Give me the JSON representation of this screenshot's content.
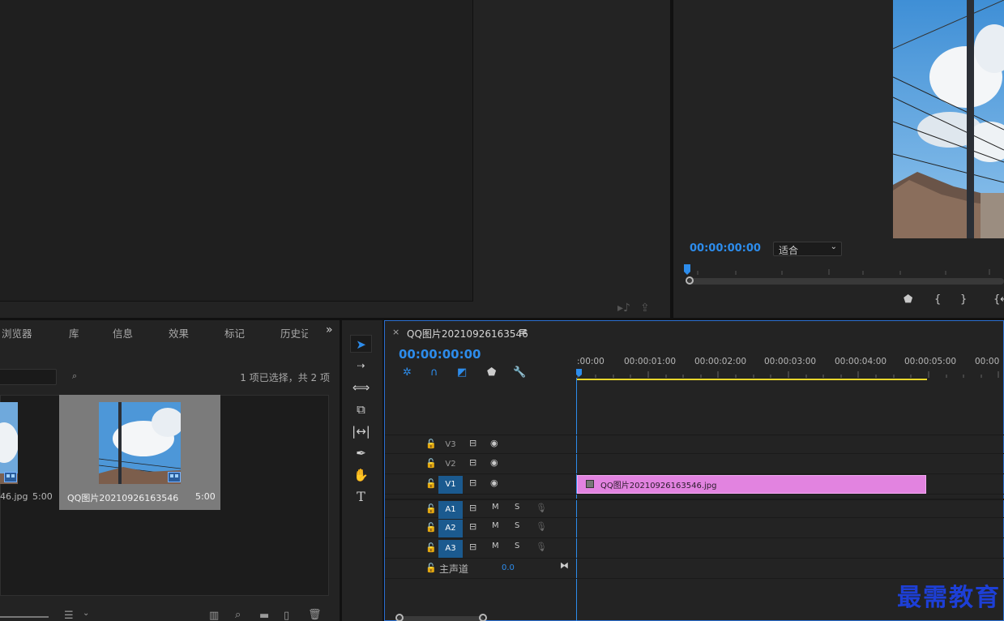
{
  "program": {
    "timecode": "00:00:00:00",
    "fit_label": "适合"
  },
  "project": {
    "tabs": [
      "浏览器",
      "库",
      "信息",
      "效果",
      "标记",
      "历史记"
    ],
    "selection_count": "1 项已选择，共 2 项",
    "items": [
      {
        "name": "46.jpg",
        "duration": "5:00"
      },
      {
        "name": "QQ图片20210926163546",
        "duration": "5:00"
      }
    ]
  },
  "timeline": {
    "close": "×",
    "sequence_name": "QQ图片20210926163546",
    "menu": "≡",
    "timecode": "00:00:00:00",
    "ruler": [
      ":00:00",
      "00:00:01:00",
      "00:00:02:00",
      "00:00:03:00",
      "00:00:04:00",
      "00:00:05:00",
      "00:00"
    ],
    "video_tracks": [
      "V3",
      "V2",
      "V1"
    ],
    "audio_tracks": [
      "A1",
      "A2",
      "A3"
    ],
    "mute": "M",
    "solo": "S",
    "master_label": "主声道",
    "master_value": "0.0",
    "clip_name": "QQ图片20210926163546.jpg"
  },
  "watermark": "最需教育",
  "colors": {
    "accent": "#2d8ceb",
    "clip": "#e283e0",
    "track_active": "#1b5a8f",
    "duration_bar": "#e8d62c"
  }
}
